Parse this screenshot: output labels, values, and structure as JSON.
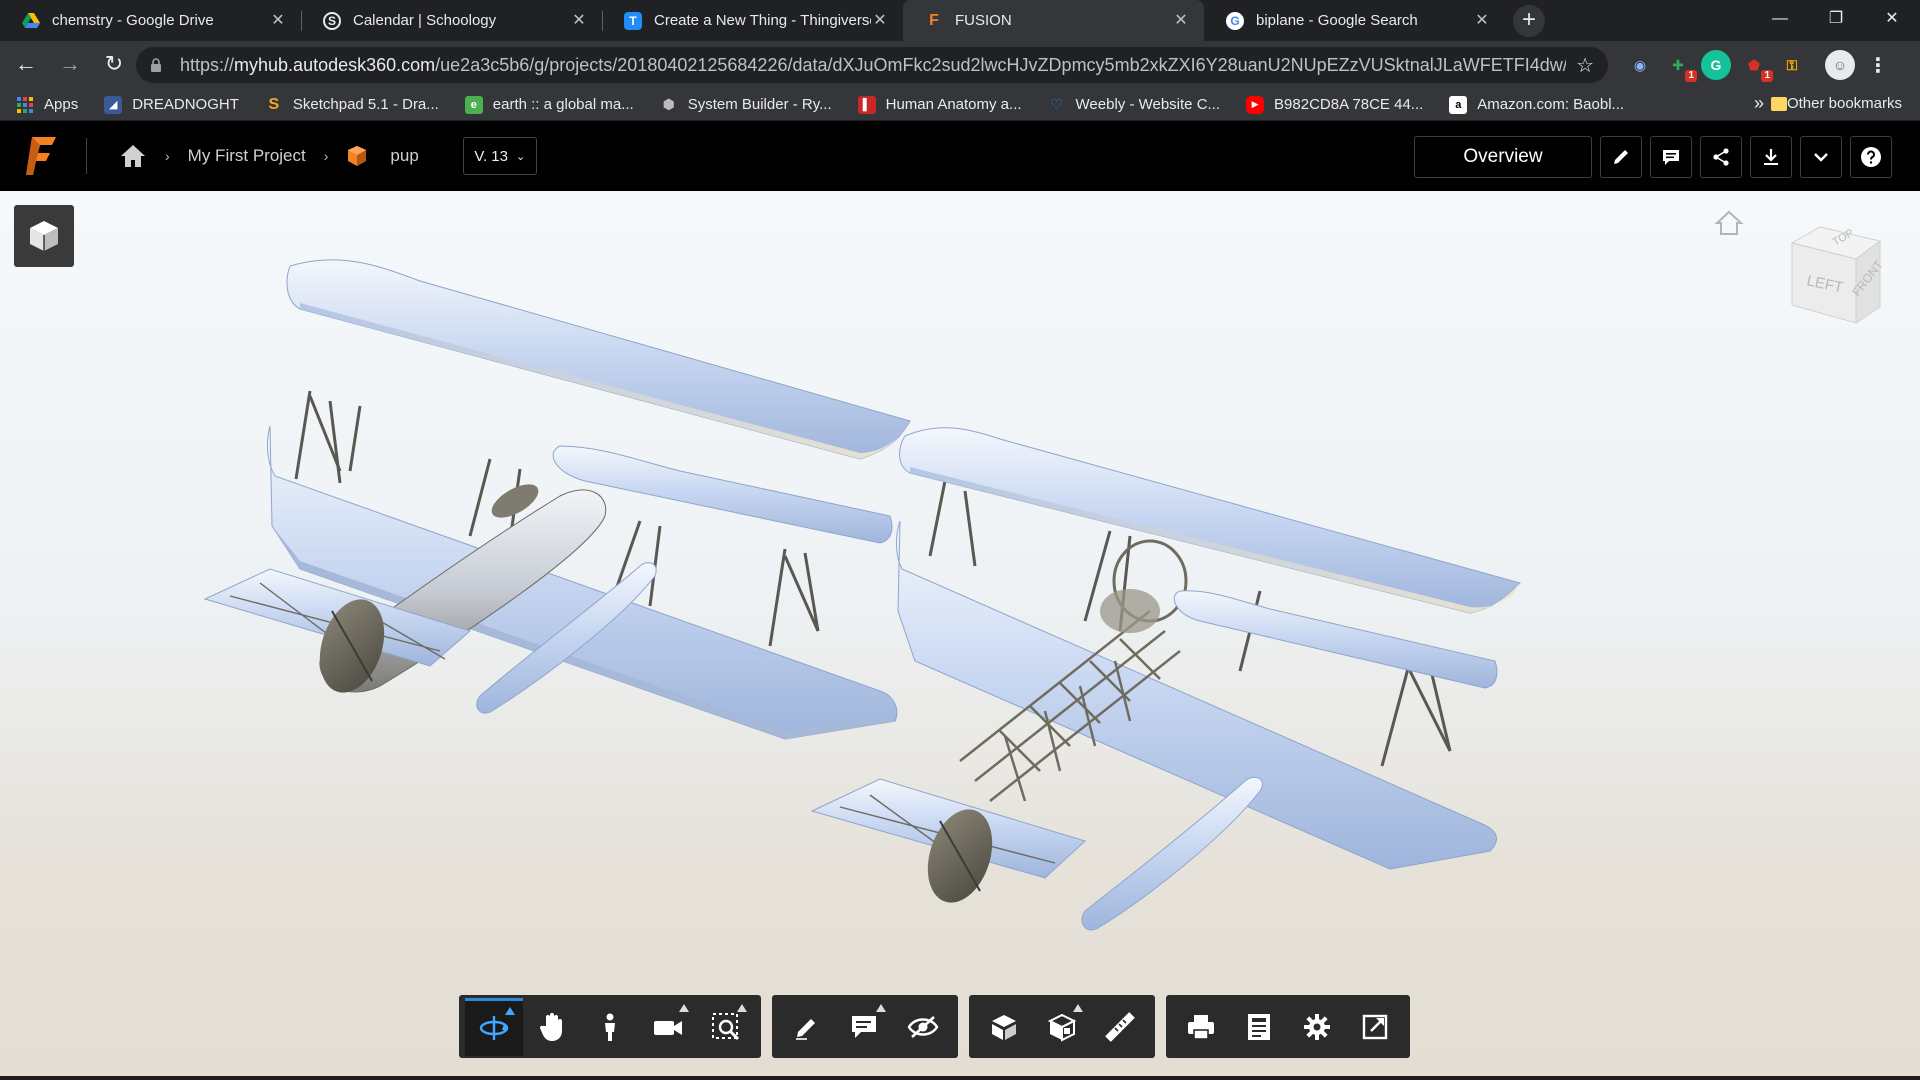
{
  "browser": {
    "tabs": [
      {
        "title": "chemstry - Google Drive",
        "icon": "google-drive-icon",
        "color": "#fbbc04"
      },
      {
        "title": "Calendar | Schoology",
        "icon": "schoology-icon",
        "color": "#e8eaed"
      },
      {
        "title": "Create a New Thing - Thingiverse",
        "icon": "thingiverse-icon",
        "color": "#248bfb"
      },
      {
        "title": "FUSION",
        "icon": "fusion-icon",
        "color": "#f58220",
        "active": true
      },
      {
        "title": "biplane - Google Search",
        "icon": "google-icon",
        "color": "#4285f4"
      }
    ],
    "url_host": "myhub.autodesk360.com",
    "url_prefix": "https://",
    "url_path": "/ue2a3c5b6/g/projects/20180402125684226/data/dXJuOmFkc2sud2lwcHJvZDpmcy5mb2xkZXI6Y28uanU2NUpEZzVUSktnalJLaWFETFI4dw/dXJu...",
    "bookmarks": [
      {
        "label": "Apps",
        "icon": "apps-grid-icon",
        "color": "#4285f4"
      },
      {
        "label": "DREADNOGHT",
        "icon": "bookmark-dreadnoght-icon",
        "color": "#3b5998"
      },
      {
        "label": "Sketchpad 5.1 - Dra...",
        "icon": "sketchpad-icon",
        "color": "#f5a623"
      },
      {
        "label": "earth :: a global ma...",
        "icon": "earth-icon",
        "color": "#4caf50"
      },
      {
        "label": "System Builder - Ry...",
        "icon": "system-builder-icon",
        "color": "#888888"
      },
      {
        "label": "Human Anatomy a...",
        "icon": "anatomy-icon",
        "color": "#c62828"
      },
      {
        "label": "Weebly - Website C...",
        "icon": "weebly-icon",
        "color": "#1e88e5"
      },
      {
        "label": "B982CD8A 78CE 44...",
        "icon": "youtube-icon",
        "color": "#ff0000"
      },
      {
        "label": "Amazon.com: Baobl...",
        "icon": "amazon-icon",
        "color": "#ffffff"
      }
    ],
    "bookmarks_more": "»",
    "other_bookmarks": "Other bookmarks",
    "extension_badges": [
      "1",
      "1"
    ]
  },
  "fusion": {
    "breadcrumb": {
      "project": "My First Project",
      "item": "pup"
    },
    "version": "V. 13",
    "overview_label": "Overview",
    "viewcube": {
      "top": "TOP",
      "left": "LEFT",
      "front": "FRONT"
    },
    "accent": "#2b8ad8"
  }
}
